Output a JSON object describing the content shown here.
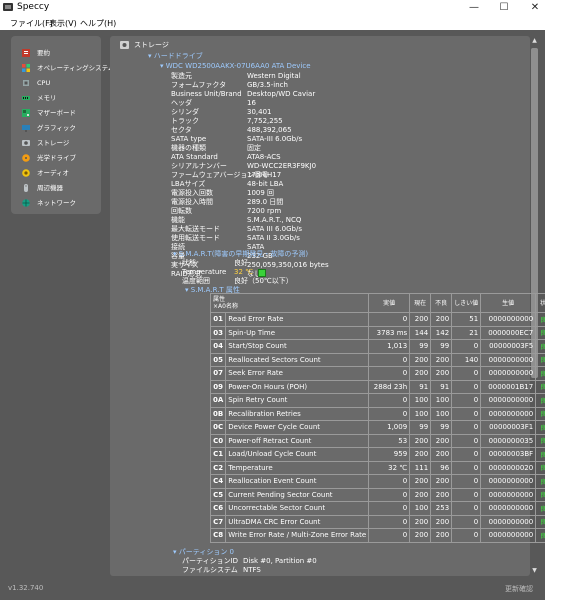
{
  "window": {
    "title": "Speccy",
    "minimize": "—",
    "maximize": "☐",
    "close": "✕"
  },
  "menu": [
    "ファイル(F)",
    "表示(V)",
    "ヘルプ(H)"
  ],
  "sidebar": {
    "items": [
      {
        "label": "要約",
        "icon": "summary-icon",
        "color": "#c0392b"
      },
      {
        "label": "オペレーティングシステム",
        "icon": "windows-icon",
        "color": "#e67e22"
      },
      {
        "label": "CPU",
        "icon": "cpu-icon",
        "color": "#95a5a6"
      },
      {
        "label": "メモリ",
        "icon": "memory-icon",
        "color": "#27ae60"
      },
      {
        "label": "マザーボード",
        "icon": "motherboard-icon",
        "color": "#27ae60"
      },
      {
        "label": "グラフィック",
        "icon": "graphics-icon",
        "color": "#2980b9"
      },
      {
        "label": "ストレージ",
        "icon": "storage-icon",
        "color": "#7f8c8d"
      },
      {
        "label": "光学ドライブ",
        "icon": "optical-drive-icon",
        "color": "#f39c12"
      },
      {
        "label": "オーディオ",
        "icon": "audio-icon",
        "color": "#f1c40f"
      },
      {
        "label": "周辺機器",
        "icon": "peripherals-icon",
        "color": "#bdc3c7"
      },
      {
        "label": "ネットワーク",
        "icon": "network-icon",
        "color": "#16a085"
      }
    ]
  },
  "main": {
    "section_title": "ストレージ",
    "hard_drive_heading": "ハードドライブ",
    "device_name": "WDC WD2500AAKX-07U6AA0 ATA Device",
    "properties": [
      {
        "label": "製造元",
        "value": "Western Digital"
      },
      {
        "label": "フォームファクタ",
        "value": "GB/3.5-inch"
      },
      {
        "label": "Business Unit/Brand",
        "value": "Desktop/WD Caviar"
      },
      {
        "label": "ヘッダ",
        "value": "16"
      },
      {
        "label": "シリンダ",
        "value": "30,401"
      },
      {
        "label": "トラック",
        "value": "7,752,255"
      },
      {
        "label": "セクタ",
        "value": "488,392,065"
      },
      {
        "label": "SATA type",
        "value": "SATA-III 6.0Gb/s"
      },
      {
        "label": "機器の種類",
        "value": "固定"
      },
      {
        "label": "ATA Standard",
        "value": "ATA8-ACS"
      },
      {
        "label": "シリアルナンバー",
        "value": "WD-WCC2ER3F9KJ0"
      },
      {
        "label": "ファームウェアバージョン番号",
        "value": "17.01H17"
      },
      {
        "label": "LBAサイズ",
        "value": "48-bit LBA"
      },
      {
        "label": "電源投入回数",
        "value": "1009 回"
      },
      {
        "label": "電源投入時間",
        "value": "289.0 日間"
      },
      {
        "label": "回転数",
        "value": "7200 rpm"
      },
      {
        "label": "機能",
        "value": "S.M.A.R.T., NCQ"
      },
      {
        "label": "最大転送モード",
        "value": "SATA III 6.0Gb/s"
      },
      {
        "label": "使用転送モード",
        "value": "SATA II 3.0Gb/s"
      },
      {
        "label": "接続",
        "value": "SATA"
      },
      {
        "label": "容量",
        "value": "232 GB"
      },
      {
        "label": "実サイズ",
        "value": "250,059,350,016 bytes"
      },
      {
        "label": "RAID形式",
        "value": "なし"
      }
    ],
    "smart_heading": "S.M.A.R.T(障害の早期発見・故障の予測)",
    "smart_status": {
      "status_label": "状態",
      "status_value": "良好",
      "temperature_label": "Temperature",
      "temperature_value": "32 ℃",
      "temp_range_label": "温度範囲",
      "temp_range_value": "良好（50℃以下）"
    },
    "smart_attr_heading": "S.M.A.R.T 属性",
    "smart_table": {
      "headers": {
        "attr": "属性",
        "attr2": "×A0名称",
        "actual": "実値",
        "current": "現在",
        "worst": "不良",
        "threshold": "しきい値",
        "raw": "生値",
        "status": "状態"
      },
      "rows": [
        {
          "id": "01",
          "name": "Read Error Rate",
          "actual": "0",
          "current": "200",
          "worst": "200",
          "threshold": "51",
          "raw": "0000000000",
          "status": "良好"
        },
        {
          "id": "03",
          "name": "Spin-Up Time",
          "actual": "3783 ms",
          "current": "144",
          "worst": "142",
          "threshold": "21",
          "raw": "0000000EC7",
          "status": "良好"
        },
        {
          "id": "04",
          "name": "Start/Stop Count",
          "actual": "1,013",
          "current": "99",
          "worst": "99",
          "threshold": "0",
          "raw": "00000003F5",
          "status": "良好"
        },
        {
          "id": "05",
          "name": "Reallocated Sectors Count",
          "actual": "0",
          "current": "200",
          "worst": "200",
          "threshold": "140",
          "raw": "0000000000",
          "status": "良好"
        },
        {
          "id": "07",
          "name": "Seek Error Rate",
          "actual": "0",
          "current": "200",
          "worst": "200",
          "threshold": "0",
          "raw": "0000000000",
          "status": "良好"
        },
        {
          "id": "09",
          "name": "Power-On Hours (POH)",
          "actual": "288d 23h",
          "current": "91",
          "worst": "91",
          "threshold": "0",
          "raw": "0000001B17",
          "status": "良好"
        },
        {
          "id": "0A",
          "name": "Spin Retry Count",
          "actual": "0",
          "current": "100",
          "worst": "100",
          "threshold": "0",
          "raw": "0000000000",
          "status": "良好"
        },
        {
          "id": "0B",
          "name": "Recalibration Retries",
          "actual": "0",
          "current": "100",
          "worst": "100",
          "threshold": "0",
          "raw": "0000000000",
          "status": "良好"
        },
        {
          "id": "0C",
          "name": "Device Power Cycle Count",
          "actual": "1,009",
          "current": "99",
          "worst": "99",
          "threshold": "0",
          "raw": "00000003F1",
          "status": "良好"
        },
        {
          "id": "C0",
          "name": "Power-off Retract Count",
          "actual": "53",
          "current": "200",
          "worst": "200",
          "threshold": "0",
          "raw": "0000000035",
          "status": "良好"
        },
        {
          "id": "C1",
          "name": "Load/Unload Cycle Count",
          "actual": "959",
          "current": "200",
          "worst": "200",
          "threshold": "0",
          "raw": "00000003BF",
          "status": "良好"
        },
        {
          "id": "C2",
          "name": "Temperature",
          "actual": "32 ℃",
          "current": "111",
          "worst": "96",
          "threshold": "0",
          "raw": "0000000020",
          "status": "良好"
        },
        {
          "id": "C4",
          "name": "Reallocation Event Count",
          "actual": "0",
          "current": "200",
          "worst": "200",
          "threshold": "0",
          "raw": "0000000000",
          "status": "良好"
        },
        {
          "id": "C5",
          "name": "Current Pending Sector Count",
          "actual": "0",
          "current": "200",
          "worst": "200",
          "threshold": "0",
          "raw": "0000000000",
          "status": "良好"
        },
        {
          "id": "C6",
          "name": "Uncorrectable Sector Count",
          "actual": "0",
          "current": "100",
          "worst": "253",
          "threshold": "0",
          "raw": "0000000000",
          "status": "良好"
        },
        {
          "id": "C7",
          "name": "UltraDMA CRC Error Count",
          "actual": "0",
          "current": "200",
          "worst": "200",
          "threshold": "0",
          "raw": "0000000000",
          "status": "良好"
        },
        {
          "id": "C8",
          "name": "Write Error Rate / Multi-Zone Error Rate",
          "actual": "0",
          "current": "200",
          "worst": "200",
          "threshold": "0",
          "raw": "0000000000",
          "status": "良好"
        }
      ]
    },
    "partition_heading": "パーティション 0",
    "partition": [
      {
        "label": "パーティションID",
        "value": "Disk #0, Partition #0"
      },
      {
        "label": "ファイルシステム",
        "value": "NTFS"
      }
    ]
  },
  "footer": {
    "version": "v1.32.740",
    "update": "更新確認"
  },
  "colors": {
    "app_bg": "#585858",
    "panel_bg": "#6a6a6a",
    "heading_blue": "#9ecbff",
    "smart_yellow": "#ffd23f",
    "ok_green": "#3ee83e"
  }
}
